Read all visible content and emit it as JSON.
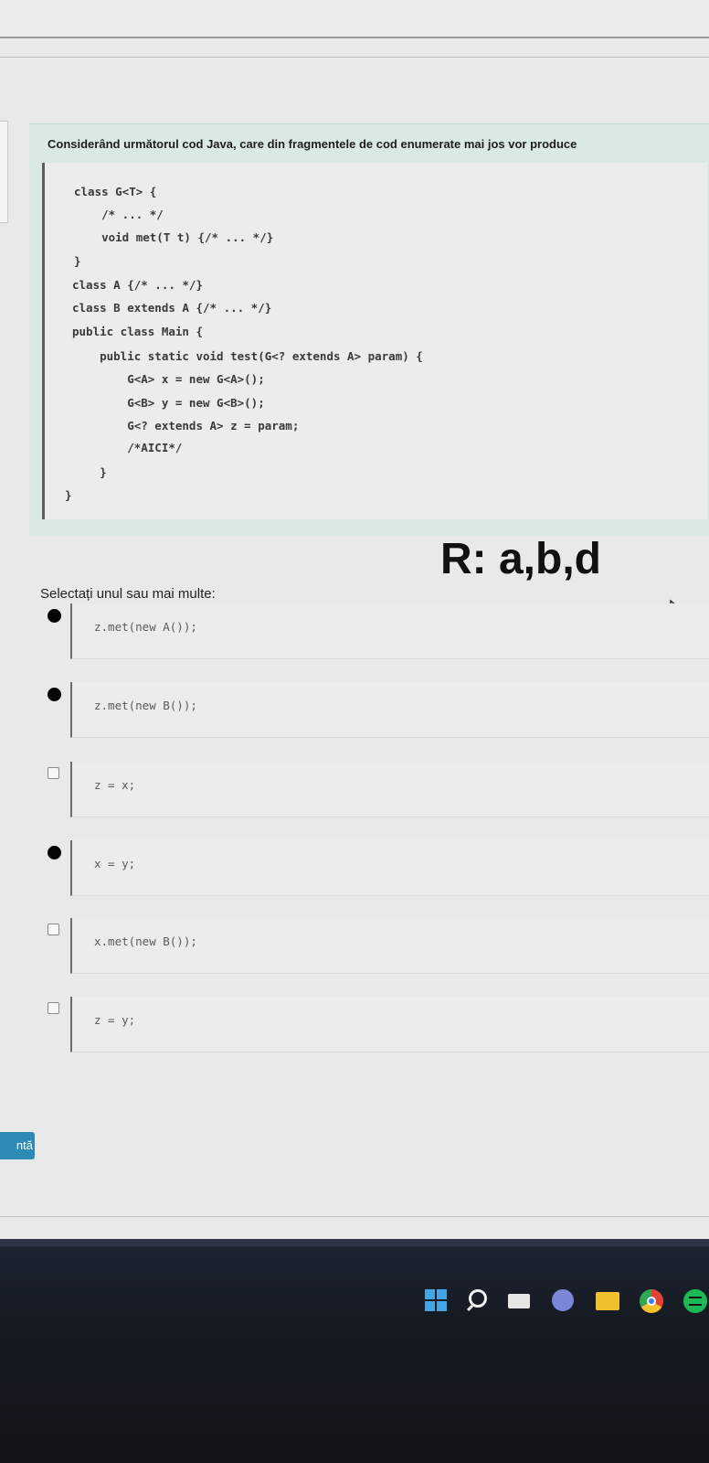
{
  "question": {
    "text": "Considerând următorul cod Java, care din fragmentele de cod enumerate mai jos vor produce",
    "code_lines": [
      "class G<T> {",
      "    /* ... */",
      "    void met(T t) {/* ... */}",
      "}",
      "class A {/* ... */}",
      "class B extends A {/* ... */}",
      "public class Main {",
      "    public static void test(G<? extends A> param) {",
      "        G<A> x = new G<A>();",
      "        G<B> y = new G<B>();",
      "        G<? extends A> z = param;",
      "        /*AICI*/",
      "    }",
      "}"
    ]
  },
  "answer_note": "R: a,b,d",
  "prompt": "Selectați unul sau mai multe:",
  "options": [
    {
      "code": "z.met(new A());",
      "checked": true
    },
    {
      "code": "z.met(new B());",
      "checked": true
    },
    {
      "code": "z = x;",
      "checked": false
    },
    {
      "code": "x = y;",
      "checked": true
    },
    {
      "code": "x.met(new B());",
      "checked": false
    },
    {
      "code": "z = y;",
      "checked": false
    }
  ],
  "next_button": "ntă",
  "taskbar": {
    "icons": [
      "windows-start-icon",
      "search-icon",
      "tv-icon",
      "meet-icon",
      "folder-icon",
      "chrome-icon",
      "spotify-icon"
    ]
  },
  "colors": {
    "question_bg": "#dbe9e4",
    "button_blue": "#2d8ab4",
    "taskbar": "#1a1f29"
  }
}
